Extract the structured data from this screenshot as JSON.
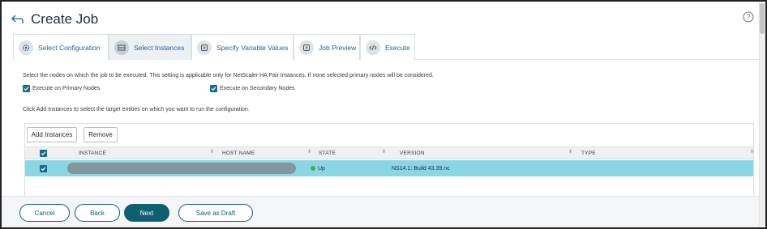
{
  "header": {
    "title": "Create Job"
  },
  "tabs": [
    {
      "label": "Select Configuration",
      "icon": "gear-icon"
    },
    {
      "label": "Select Instances",
      "icon": "instances-icon"
    },
    {
      "label": "Specify Variable Values",
      "icon": "variables-icon"
    },
    {
      "label": "Job Preview",
      "icon": "preview-icon"
    },
    {
      "label": "Execute",
      "icon": "code-icon"
    }
  ],
  "content": {
    "description": "Select the nodes on which the job to be executed. This setting is applicable only for NetScaler HA Pair Instances. If none selected primary nodes will be considered.",
    "primary_nodes_label": "Execute on Primary Nodes",
    "secondary_nodes_label": "Execute on Secondary Nodes",
    "hint": "Click Add Instances to select the target entities on which you want to run the configuration."
  },
  "table": {
    "add_label": "Add Instances",
    "remove_label": "Remove",
    "columns": [
      "INSTANCE",
      "HOST NAME",
      "STATE",
      "VERSION",
      "TYPE"
    ],
    "rows": [
      {
        "instance": "",
        "host_name": "",
        "state": "Up",
        "version": "NS14.1: Build 43.39.nc",
        "type": ""
      }
    ]
  },
  "footer": {
    "cancel": "Cancel",
    "back": "Back",
    "next": "Next",
    "draft": "Save as Draft"
  },
  "colors": {
    "accent": "#0f5f72",
    "selected_row": "#8ad7e3",
    "status_up": "#3bb54a",
    "link": "#1d5f9e"
  }
}
